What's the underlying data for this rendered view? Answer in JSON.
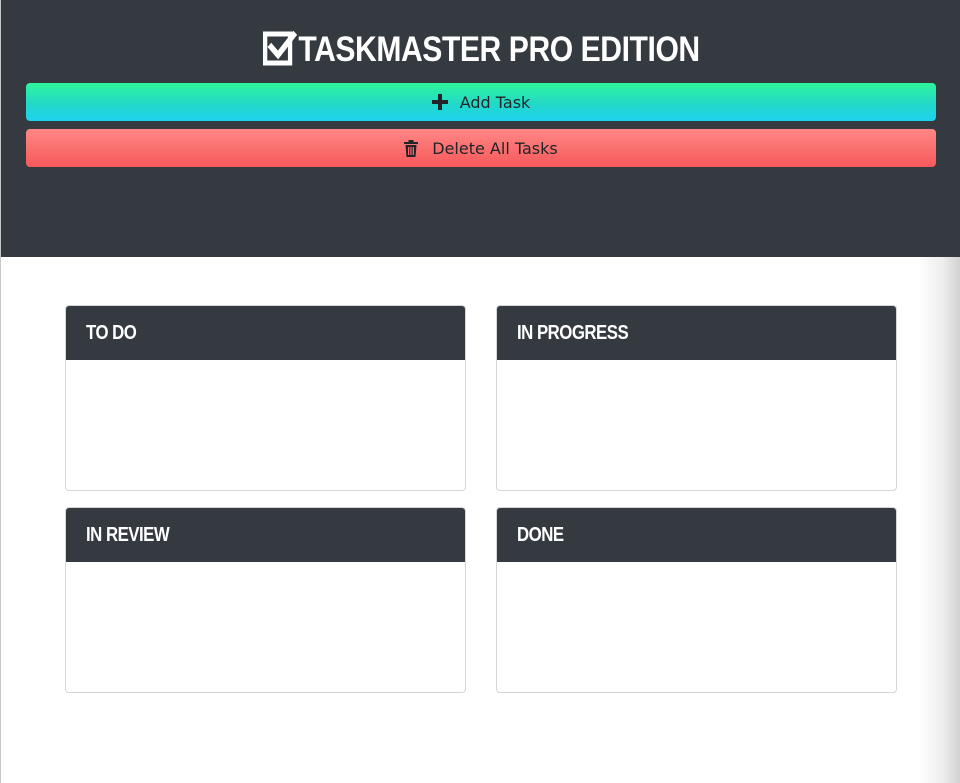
{
  "app": {
    "title": "TASKMASTER PRO EDITION",
    "title_icon": "checkbox-icon"
  },
  "toolbar": {
    "add_label": "Add Task",
    "add_icon": "plus-icon",
    "delete_label": "Delete All Tasks",
    "delete_icon": "trash-icon"
  },
  "board": {
    "columns": [
      {
        "label": "TO DO",
        "tasks": []
      },
      {
        "label": "IN PROGRESS",
        "tasks": []
      },
      {
        "label": "IN REVIEW",
        "tasks": []
      },
      {
        "label": "DONE",
        "tasks": []
      }
    ]
  },
  "colors": {
    "header_bg": "#343a40",
    "add_gradient": [
      "#2ff59a",
      "#1fd3ef"
    ],
    "delete_gradient": [
      "#ff8785",
      "#f6595b"
    ]
  }
}
